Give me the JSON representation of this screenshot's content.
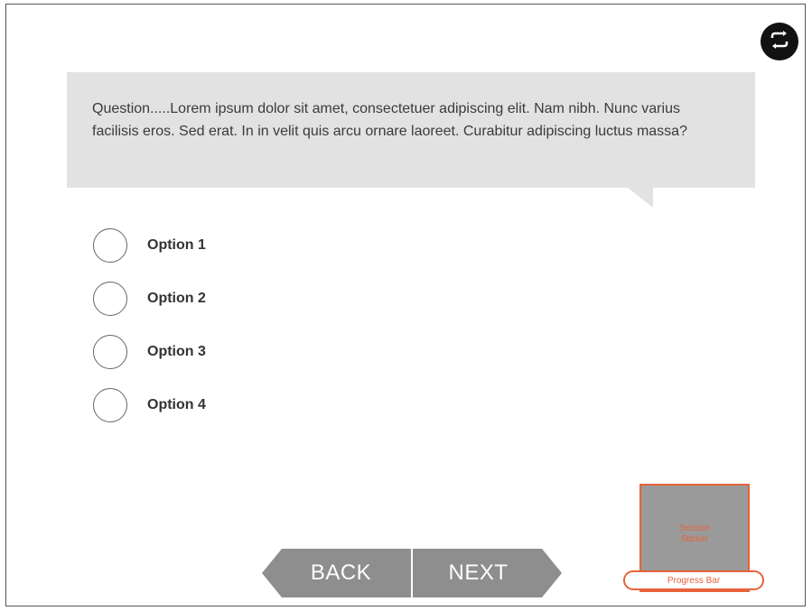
{
  "question": {
    "text": "Question.....Lorem ipsum dolor sit amet, consectetuer adipiscing elit. Nam nibh. Nunc varius facilisis eros. Sed erat. In in velit quis arcu ornare laoreet. Curabitur adipiscing luctus massa?"
  },
  "options": [
    {
      "label": "Option 1"
    },
    {
      "label": "Option 2"
    },
    {
      "label": "Option 3"
    },
    {
      "label": "Option 4"
    }
  ],
  "navigation": {
    "back_label": "BACK",
    "next_label": "NEXT"
  },
  "sticker": {
    "label": "Section Sticker"
  },
  "progress": {
    "label": "Progress Bar"
  },
  "icons": {
    "top_right": "repeat-icon"
  },
  "colors": {
    "accent": "#e8633a",
    "nav_button": "#8e8e8e",
    "question_bg": "#e2e2e2"
  }
}
